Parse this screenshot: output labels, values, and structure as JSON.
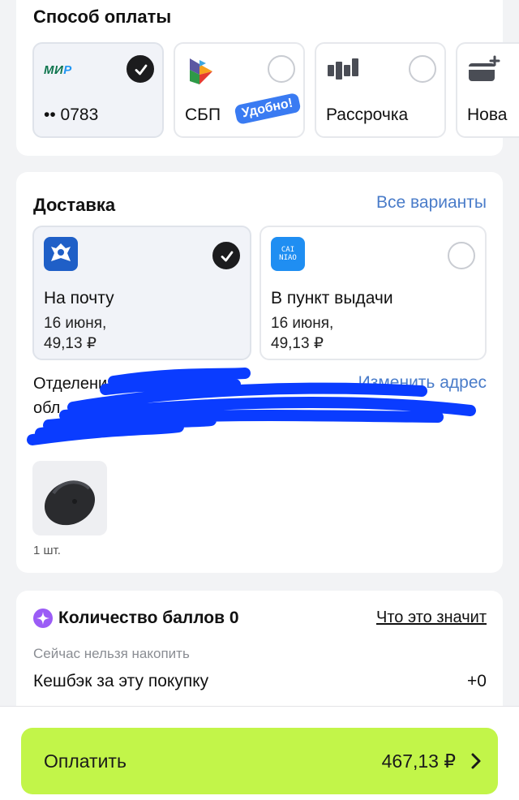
{
  "payment": {
    "title": "Способ оплаты",
    "methods": [
      {
        "label": "•• 0783",
        "logo_text_a": "МИ",
        "logo_text_b": "Р",
        "selected": true
      },
      {
        "label": "СБП",
        "badge": "Удобно!",
        "selected": false
      },
      {
        "label": "Рассрочка",
        "selected": false
      },
      {
        "label": "Нова",
        "selected": false
      }
    ]
  },
  "delivery": {
    "title": "Доставка",
    "all_options_link": "Все варианты",
    "options": [
      {
        "name": "На почту",
        "date": "16 июня,",
        "price": "49,13 ₽",
        "selected": true,
        "icon": "russian-post-logo"
      },
      {
        "name": "В пункт выдачи",
        "date": "16 июня,",
        "price": "49,13 ₽",
        "selected": false,
        "icon": "cainiao-logo",
        "logo_text_top": "CAI",
        "logo_text_bottom": "NIAO"
      }
    ],
    "address_line1": "Отделени",
    "address_line2": "обл.",
    "change_address_link": "Изменить адрес",
    "product_qty": "1 шт."
  },
  "bonus": {
    "title": "Количество баллов 0",
    "info_link": "Что это значит",
    "subtitle": "Сейчас нельзя накопить",
    "cashback_label": "Кешбэк за эту покупку",
    "cashback_value": "+0"
  },
  "checkout": {
    "button_label": "Оплатить",
    "total": "467,13 ₽"
  },
  "colors": {
    "accent_green": "#c2f549",
    "link_blue": "#4a7cc9",
    "scribble_blue": "#0a3cff"
  }
}
